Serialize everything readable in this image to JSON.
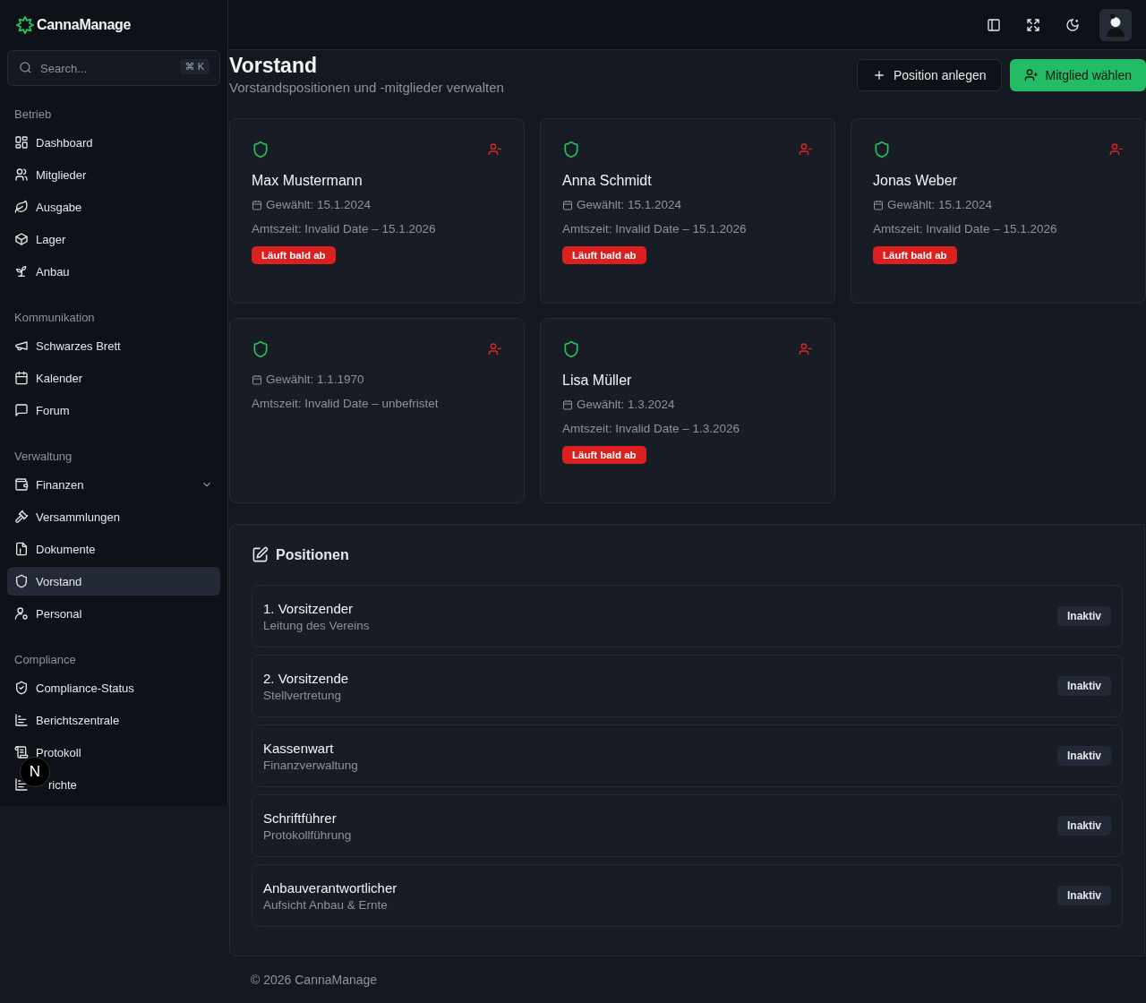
{
  "app": {
    "name": "CannaManage"
  },
  "search": {
    "placeholder": "Search...",
    "shortcut": "⌘ K"
  },
  "sidebar": {
    "sections": [
      {
        "title": "Betrieb",
        "items": [
          {
            "label": "Dashboard",
            "selected": false
          },
          {
            "label": "Mitglieder",
            "selected": false
          },
          {
            "label": "Ausgabe",
            "selected": false
          },
          {
            "label": "Lager",
            "selected": false
          },
          {
            "label": "Anbau",
            "selected": false
          }
        ]
      },
      {
        "title": "Kommunikation",
        "items": [
          {
            "label": "Schwarzes Brett",
            "selected": false
          },
          {
            "label": "Kalender",
            "selected": false
          },
          {
            "label": "Forum",
            "selected": false
          }
        ]
      },
      {
        "title": "Verwaltung",
        "items": [
          {
            "label": "Finanzen",
            "selected": false,
            "expandable": true
          },
          {
            "label": "Versammlungen",
            "selected": false
          },
          {
            "label": "Dokumente",
            "selected": false
          },
          {
            "label": "Vorstand",
            "selected": true
          },
          {
            "label": "Personal",
            "selected": false
          }
        ]
      },
      {
        "title": "Compliance",
        "items": [
          {
            "label": "Compliance-Status",
            "selected": false
          },
          {
            "label": "Berichtszentrale",
            "selected": false
          },
          {
            "label": "Protokoll",
            "selected": false
          },
          {
            "label": "richte",
            "selected": false,
            "covered": true
          }
        ]
      }
    ]
  },
  "dev_badge": "N",
  "page": {
    "title": "Vorstand",
    "subtitle": "Vorstandspositionen und -mitglieder verwalten"
  },
  "actions": [
    {
      "label": "Position anlegen",
      "kind": "outline"
    },
    {
      "label": "Mitglied wählen",
      "kind": "primary"
    }
  ],
  "members": [
    {
      "name": "Max Mustermann",
      "elected": "Gewählt: 15.1.2024",
      "term": "Amtszeit: Invalid Date – 15.1.2026",
      "badge": "Läuft bald ab"
    },
    {
      "name": "Anna Schmidt",
      "elected": "Gewählt: 15.1.2024",
      "term": "Amtszeit: Invalid Date – 15.1.2026",
      "badge": "Läuft bald ab"
    },
    {
      "name": "Jonas Weber",
      "elected": "Gewählt: 15.1.2024",
      "term": "Amtszeit: Invalid Date – 15.1.2026",
      "badge": "Läuft bald ab"
    },
    {
      "elected": "Gewählt: 1.1.1970",
      "term": "Amtszeit: Invalid Date – unbefristet"
    },
    {
      "name": "Lisa Müller",
      "elected": "Gewählt: 1.3.2024",
      "term": "Amtszeit: Invalid Date – 1.3.2026",
      "badge": "Läuft bald ab"
    }
  ],
  "positions": {
    "title": "Positionen",
    "items": [
      {
        "title": "1. Vorsitzender",
        "description": "Leitung des Vereins",
        "status": "Inaktiv"
      },
      {
        "title": "2. Vorsitzende",
        "description": "Stellvertretung",
        "status": "Inaktiv"
      },
      {
        "title": "Kassenwart",
        "description": "Finanzverwaltung",
        "status": "Inaktiv"
      },
      {
        "title": "Schriftführer",
        "description": "Protokollführung",
        "status": "Inaktiv"
      },
      {
        "title": "Anbauverantwortlicher",
        "description": "Aufsicht Anbau & Ernte",
        "status": "Inaktiv"
      }
    ]
  },
  "footer": "© 2026 CannaManage"
}
